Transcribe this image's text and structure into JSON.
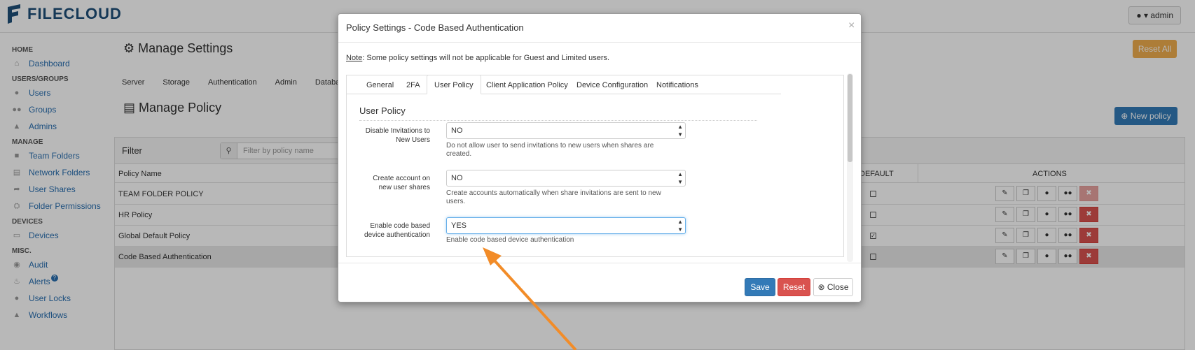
{
  "app": {
    "logo_text": "FILECLOUD",
    "admin_label": "admin"
  },
  "sidebar": {
    "sections": [
      {
        "heading": "HOME",
        "items": [
          {
            "label": "Dashboard",
            "icon": "home-icon"
          }
        ]
      },
      {
        "heading": "USERS/GROUPS",
        "items": [
          {
            "label": "Users",
            "icon": "user-icon"
          },
          {
            "label": "Groups",
            "icon": "users-icon"
          },
          {
            "label": "Admins",
            "icon": "admin-icon"
          }
        ]
      },
      {
        "heading": "MANAGE",
        "items": [
          {
            "label": "Team Folders",
            "icon": "folder-icon"
          },
          {
            "label": "Network Folders",
            "icon": "network-folder-icon"
          },
          {
            "label": "User Shares",
            "icon": "share-icon"
          },
          {
            "label": "Folder Permissions",
            "icon": "folder-permissions-icon"
          }
        ]
      },
      {
        "heading": "DEVICES",
        "items": [
          {
            "label": "Devices",
            "icon": "device-icon"
          }
        ]
      },
      {
        "heading": "MISC.",
        "items": [
          {
            "label": "Audit",
            "icon": "eye-icon"
          },
          {
            "label": "Alerts",
            "icon": "bell-icon",
            "badge": "?"
          },
          {
            "label": "User Locks",
            "icon": "lock-icon"
          },
          {
            "label": "Workflows",
            "icon": "workflow-icon"
          }
        ]
      }
    ]
  },
  "main": {
    "settings_title": "Manage Settings",
    "reset_all_label": "Reset All",
    "settings_tabs": [
      "Server",
      "Storage",
      "Authentication",
      "Admin",
      "Database"
    ],
    "policy_title": "Manage Policy",
    "new_policy_label": "New policy",
    "filter_label": "Filter",
    "filter_placeholder": "Filter by policy name",
    "table": {
      "columns": [
        "Policy Name",
        "DEFAULT",
        "ACTIONS"
      ],
      "rows": [
        {
          "name": "TEAM FOLDER POLICY",
          "default": false,
          "selected": false
        },
        {
          "name": "HR Policy",
          "default": false,
          "selected": false
        },
        {
          "name": "Global Default Policy",
          "default": true,
          "selected": false
        },
        {
          "name": "Code Based Authentication",
          "default": false,
          "selected": true
        }
      ]
    }
  },
  "modal": {
    "title": "Policy Settings - Code Based Authentication",
    "note_label": "Note",
    "note_text": ": Some policy settings will not be applicable for Guest and Limited users.",
    "tabs": [
      "General",
      "2FA",
      "User Policy",
      "Client Application Policy",
      "Device Configuration",
      "Notifications"
    ],
    "active_tab": "User Policy",
    "section_heading": "User Policy",
    "fields": [
      {
        "label_line1": "Disable Invitations to",
        "label_line2": "New Users",
        "value": "NO",
        "help_line1": "Do not allow user to send invitations to new users when shares are",
        "help_line2": "created."
      },
      {
        "label_line1": "Create account on",
        "label_line2": "new user shares",
        "value": "NO",
        "help_line1": "Create accounts automatically when share invitations are sent to new",
        "help_line2": "users."
      },
      {
        "label_line1": "Enable code based",
        "label_line2": "device authentication",
        "value": "YES",
        "help_line1": "Enable code based device authentication",
        "help_line2": ""
      }
    ],
    "buttons": {
      "save": "Save",
      "reset": "Reset",
      "close": "Close"
    }
  },
  "colors": {
    "primary": "#337ab7",
    "danger": "#d9534f",
    "warning": "#f0ad4e",
    "arrow": "#f28c28"
  }
}
